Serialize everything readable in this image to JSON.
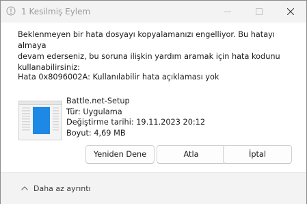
{
  "window": {
    "title": "1 Kesilmiş Eylem"
  },
  "dialog": {
    "message_line1": "Beklenmeyen bir hata dosyayı kopyalamanızı engelliyor. Bu hatayı almaya",
    "message_line2": "devam ederseniz, bu soruna ilişkin yardım aramak için hata kodunu",
    "message_line3": "kullanabilirsiniz:",
    "error_code": "Hata 0x8096002A: Kullanılabilir hata açıklaması yok"
  },
  "file": {
    "icon": "file-thumbnail-icon",
    "name": "Battle.net-Setup",
    "type": "Tür: Uygulama",
    "modified": "Değiştirme tarihi: 19.11.2023 20:12",
    "size": "Boyut: 4,69 MB"
  },
  "buttons": {
    "retry": "Yeniden Dene",
    "skip": "Atla",
    "cancel": "İptal"
  },
  "footer": {
    "less_details": "Daha az ayrıntı"
  },
  "colors": {
    "titlebar_bg": "#f3f3f3",
    "footer_bg": "#f3f3f3",
    "accent_blue": "#1e88e5"
  }
}
